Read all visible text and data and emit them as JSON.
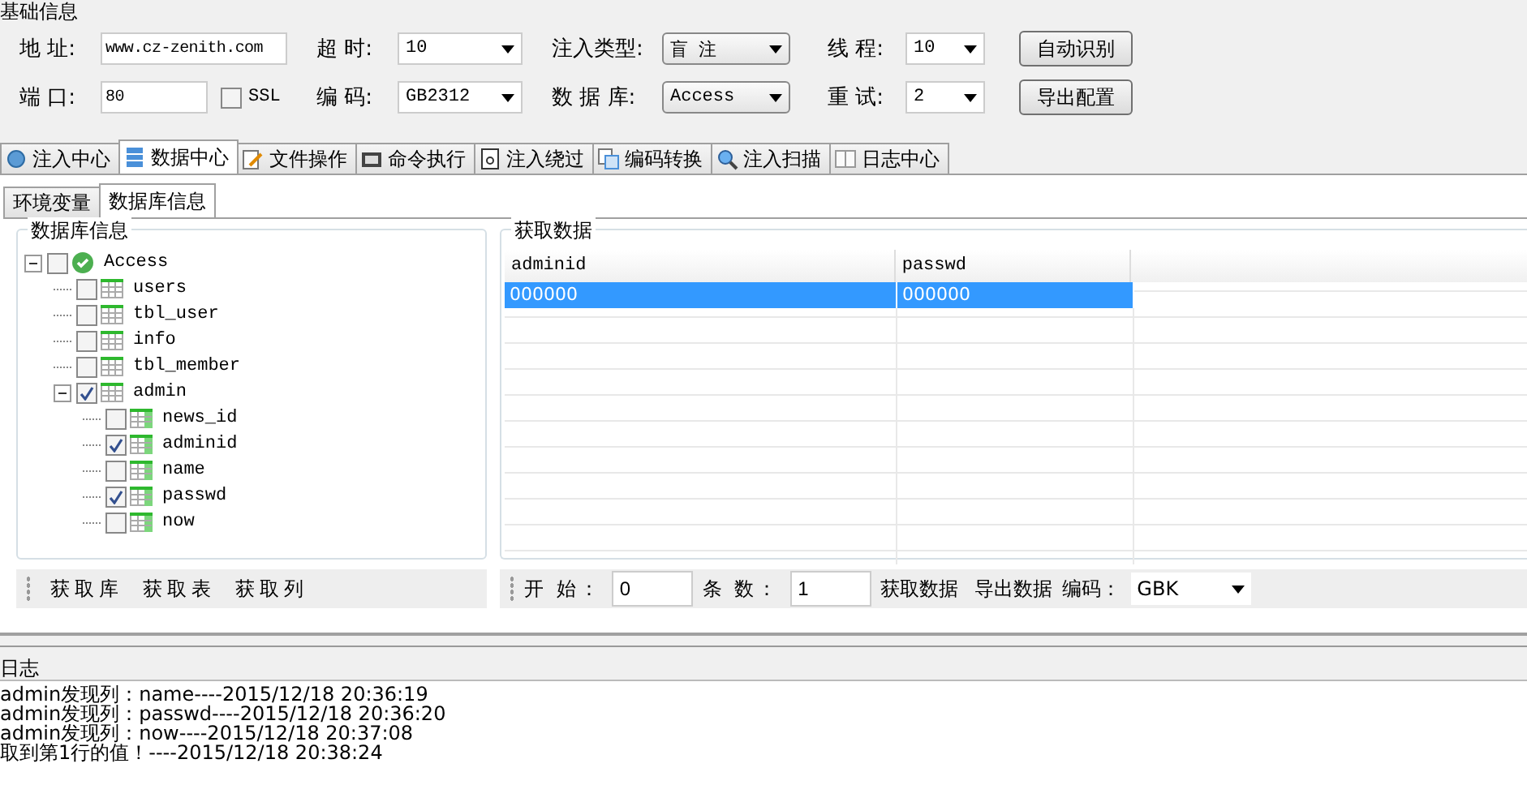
{
  "basic": {
    "title": "基础信息",
    "rows": [
      [
        {
          "kind": "text",
          "label": "地 址:",
          "value": "www.cz-zenith.com"
        },
        {
          "kind": "select",
          "label": "超 时:",
          "value": "10"
        },
        {
          "kind": "select",
          "label": "注入类型:",
          "value": "盲 注"
        },
        {
          "kind": "select",
          "label": "线 程:",
          "value": "10"
        },
        {
          "kind": "button",
          "text": "自动识别"
        }
      ],
      [
        {
          "kind": "text",
          "label": "端 口:",
          "value": "80",
          "checkbox": {
            "label": "SSL",
            "checked": false
          }
        },
        {
          "kind": "select",
          "label": "编 码:",
          "value": "GB2312"
        },
        {
          "kind": "select",
          "label": "数 据 库:",
          "value": "Access"
        },
        {
          "kind": "select",
          "label": "重 试:",
          "value": "2"
        },
        {
          "kind": "button",
          "text": "导出配置"
        }
      ]
    ]
  },
  "tabs": [
    {
      "label": "注入中心",
      "selected": false
    },
    {
      "label": "数据中心",
      "selected": true
    },
    {
      "label": "文件操作",
      "selected": false
    },
    {
      "label": "命令执行",
      "selected": false
    },
    {
      "label": "注入绕过",
      "selected": false
    },
    {
      "label": "编码转换",
      "selected": false
    },
    {
      "label": "注入扫描",
      "selected": false
    },
    {
      "label": "日志中心",
      "selected": false
    }
  ],
  "subtabs": [
    {
      "label": "环境变量",
      "selected": false
    },
    {
      "label": "数据库信息",
      "selected": true
    }
  ],
  "db_tree": {
    "title": "数据库信息",
    "root": {
      "label": "Access",
      "kind": "database",
      "checked": false,
      "expanded": true,
      "children": [
        {
          "label": "users",
          "kind": "table",
          "checked": false
        },
        {
          "label": "tbl_user",
          "kind": "table",
          "checked": false
        },
        {
          "label": "info",
          "kind": "table",
          "checked": false
        },
        {
          "label": "tbl_member",
          "kind": "table",
          "checked": false
        },
        {
          "label": "admin",
          "kind": "table",
          "checked": true,
          "expanded": true,
          "children": [
            {
              "label": "news_id",
              "kind": "column",
              "checked": false
            },
            {
              "label": "adminid",
              "kind": "column",
              "checked": true
            },
            {
              "label": "name",
              "kind": "column",
              "checked": false
            },
            {
              "label": "passwd",
              "kind": "column",
              "checked": true
            },
            {
              "label": "now",
              "kind": "column",
              "checked": false
            }
          ]
        }
      ]
    },
    "buttons": [
      "获取库",
      "获取表",
      "获取列"
    ]
  },
  "data": {
    "title": "获取数据",
    "columns": [
      "adminid",
      "passwd"
    ],
    "rows": [
      {
        "cells": [
          "000000",
          "000000"
        ],
        "selected": true
      }
    ],
    "start_label": "开 始：",
    "start_value": "0",
    "count_label": "条 数：",
    "count_value": "1",
    "buttons": [
      "获取数据",
      "导出数据"
    ],
    "encoding_label": "编码：",
    "encoding_value": "GBK"
  },
  "log": {
    "title": "日志",
    "lines": [
      "admin发现列：name----2015/12/18 20:36:19",
      "admin发现列：passwd----2015/12/18 20:36:20",
      "admin发现列：now----2015/12/18 20:37:08",
      "取到第1行的值！----2015/12/18 20:38:24"
    ]
  }
}
